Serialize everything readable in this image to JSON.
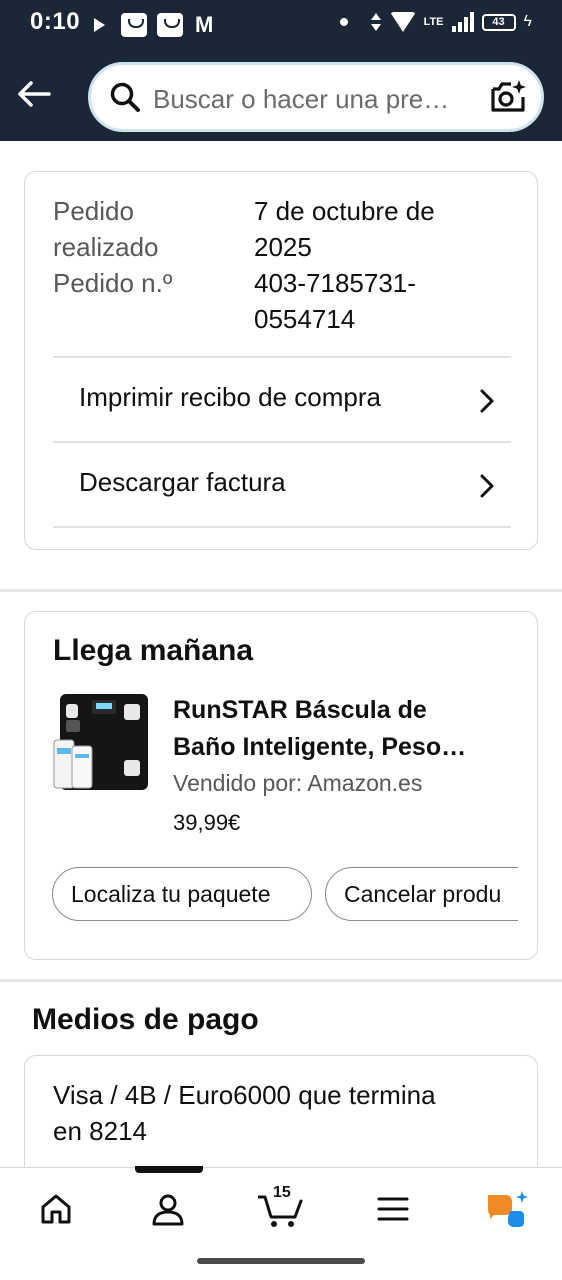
{
  "status_bar": {
    "time": "0:10",
    "network": "LTE",
    "battery": "43"
  },
  "header": {
    "search_placeholder": "Buscar o hacer una pre…",
    "icons": [
      "back-arrow-icon",
      "search-icon",
      "camera-icon"
    ]
  },
  "order_info": {
    "date_label_1": "Pedido",
    "date_label_2": "realizado",
    "date_value_1": "7 de octubre de",
    "date_value_2": "2025",
    "number_label": "Pedido n.º",
    "number_value_1": "403-7185731-",
    "number_value_2": "0554714",
    "links": [
      {
        "label": "Imprimir recibo de compra"
      },
      {
        "label": "Descargar factura"
      }
    ]
  },
  "delivery": {
    "title": "Llega mañana",
    "product": {
      "title_line1": "RunSTAR Báscula de",
      "title_line2": "Baño Inteligente, Peso…",
      "seller": "Vendido por: Amazon.es",
      "price": "39,99€"
    },
    "buttons": [
      {
        "label": "Localiza tu paquete"
      },
      {
        "label": "Cancelar produ"
      }
    ]
  },
  "payment": {
    "section_title": "Medios de pago",
    "line1": "Visa / 4B / Euro6000  que termina",
    "line2": "en 8214"
  },
  "bottom_nav": {
    "cart_count": "15",
    "items": [
      "home-icon",
      "account-icon",
      "cart-icon",
      "menu-icon",
      "rufus-icon"
    ]
  },
  "colors": {
    "header_bg": "#1b2636",
    "text_primary": "#0f1111",
    "text_secondary": "#565959",
    "rufus_orange": "#f08a24",
    "rufus_blue": "#1f8ce6"
  }
}
